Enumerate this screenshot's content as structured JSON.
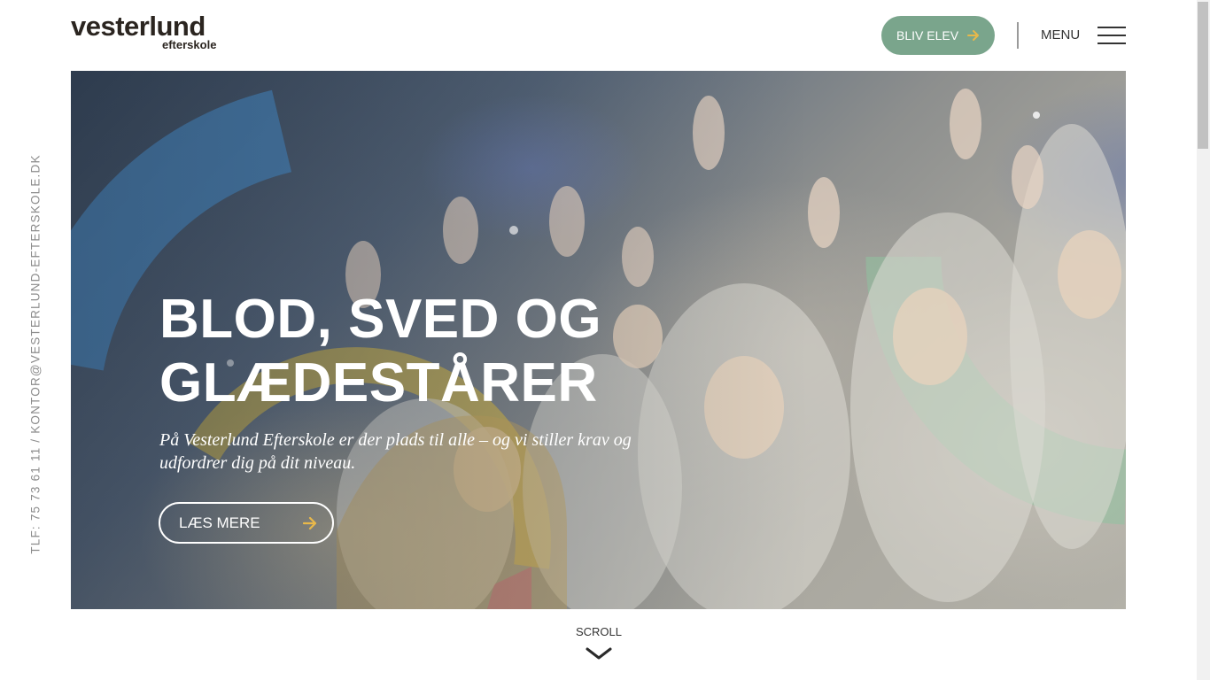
{
  "header": {
    "logo_main": "vesterlund",
    "logo_sub": "efterskole",
    "cta_label": "BLIV ELEV",
    "cta_icon": "arrow-right-icon",
    "menu_label": "MENU",
    "menu_icon": "hamburger-icon"
  },
  "side": {
    "contact": "TLF: 75 73 61 11 / KONTOR@VESTERLUND-EFTERSKOLE.DK"
  },
  "hero": {
    "title_line1": "BLOD, SVED OG",
    "title_line2": "GLÆDESTÅRER",
    "text": "På Vesterlund Efterskole er der plads til alle – og vi stiller krav og udfordrer dig på dit niveau.",
    "button_label": "LÆS MERE",
    "button_icon": "arrow-right-icon"
  },
  "scroll": {
    "label": "SCROLL",
    "icon": "chevron-down-icon"
  },
  "colors": {
    "cta_bg": "#7aa58c",
    "arrow_accent": "#e8b84a",
    "logo": "#2b2520",
    "arc_blue": "#4a8cc7",
    "arc_yellow": "#e5c23f",
    "arc_green": "#8fc2a0",
    "arc_pink": "#c75a8a"
  }
}
